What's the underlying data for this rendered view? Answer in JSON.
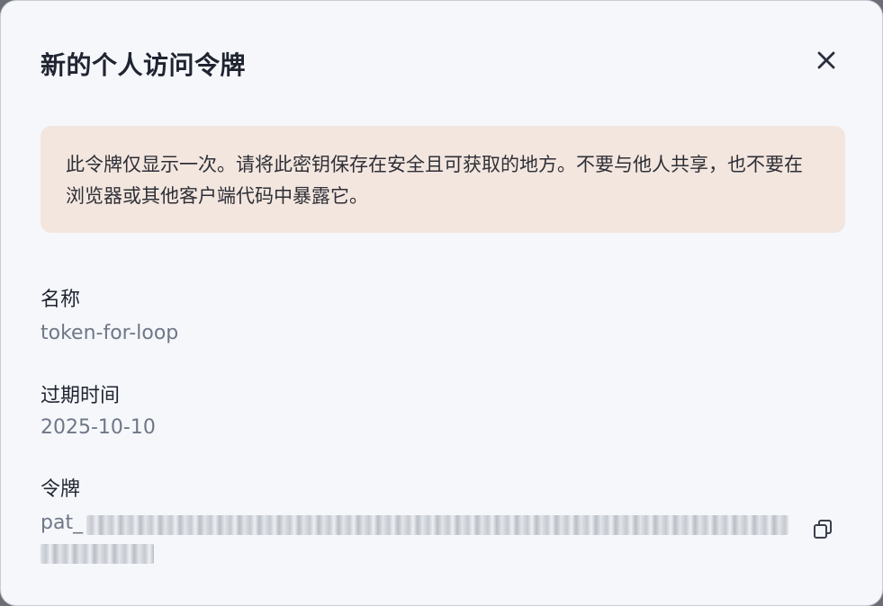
{
  "dialog": {
    "title": "新的个人访问令牌",
    "close_icon": "close-icon",
    "notice": "此令牌仅显示一次。请将此密钥保存在安全且可获取的地方。不要与他人共享，也不要在浏览器或其他客户端代码中暴露它。",
    "notice_bg": "#f3e6df",
    "fields": {
      "name_label": "名称",
      "name_value": "token-for-loop",
      "expiry_label": "过期时间",
      "expiry_value": "2025-10-10",
      "token_label": "令牌",
      "token_prefix": "pat_",
      "token_obscured": true
    },
    "copy_icon": "copy-icon"
  }
}
